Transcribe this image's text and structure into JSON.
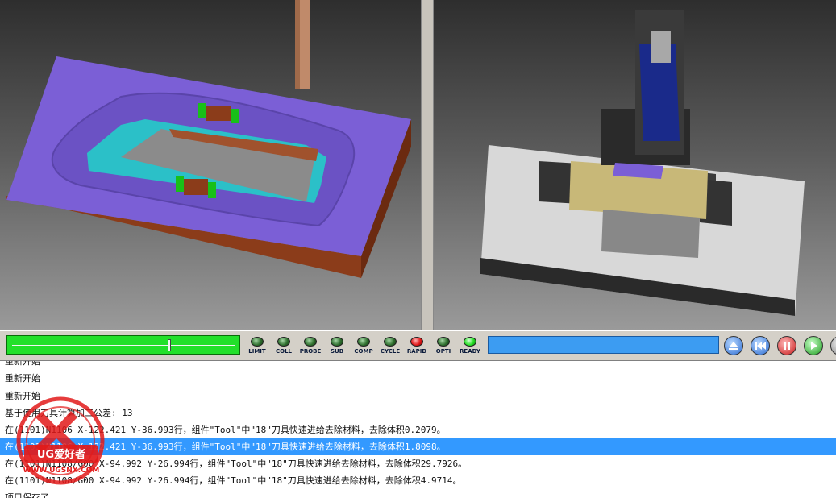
{
  "indicators": [
    {
      "label": "LIMIT",
      "state": "off"
    },
    {
      "label": "COLL",
      "state": "off"
    },
    {
      "label": "PROBE",
      "state": "off"
    },
    {
      "label": "SUB",
      "state": "off"
    },
    {
      "label": "COMP",
      "state": "off"
    },
    {
      "label": "CYCLE",
      "state": "off"
    },
    {
      "label": "RAPID",
      "state": "red"
    },
    {
      "label": "OPTI",
      "state": "off"
    },
    {
      "label": "READY",
      "state": "on"
    }
  ],
  "playback": {
    "speed_level": 0.7,
    "buttons": [
      "eject-icon",
      "rewind-icon",
      "pause-icon",
      "play-icon"
    ]
  },
  "log": {
    "lines": [
      "重新开始",
      "重新开始",
      "重新开始",
      "基于使用刀具计算加工公差: 13",
      "在(1101)N1106 X-122.421 Y-36.993行，组件\"Tool\"中\"18\"刀具快速进给去除材料，去除体积0.2079。",
      "在(1101)N1106 X-122.421 Y-36.993行，组件\"Tool\"中\"18\"刀具快速进给去除材料，去除体积1.8098。",
      "在(1101)N1108/G00 X-94.992 Y-26.994行，组件\"Tool\"中\"18\"刀具快速进给去除材料，去除体积29.7926。",
      "在(1101)N1108/G00 X-94.992 Y-26.994行，组件\"Tool\"中\"18\"刀具快速进给去除材料，去除体积4.9714。",
      "项目保存了。"
    ],
    "selected_index": 5
  },
  "watermark": {
    "brand": "UG爱好者",
    "url": "WWW.UGSNX.COM"
  },
  "colors": {
    "slider_green": "#22e02a",
    "progress_blue": "#3c9cf2",
    "selection_blue": "#3399ff",
    "part_purple": "#7b5fd6",
    "part_brown": "#8a4a2a"
  }
}
